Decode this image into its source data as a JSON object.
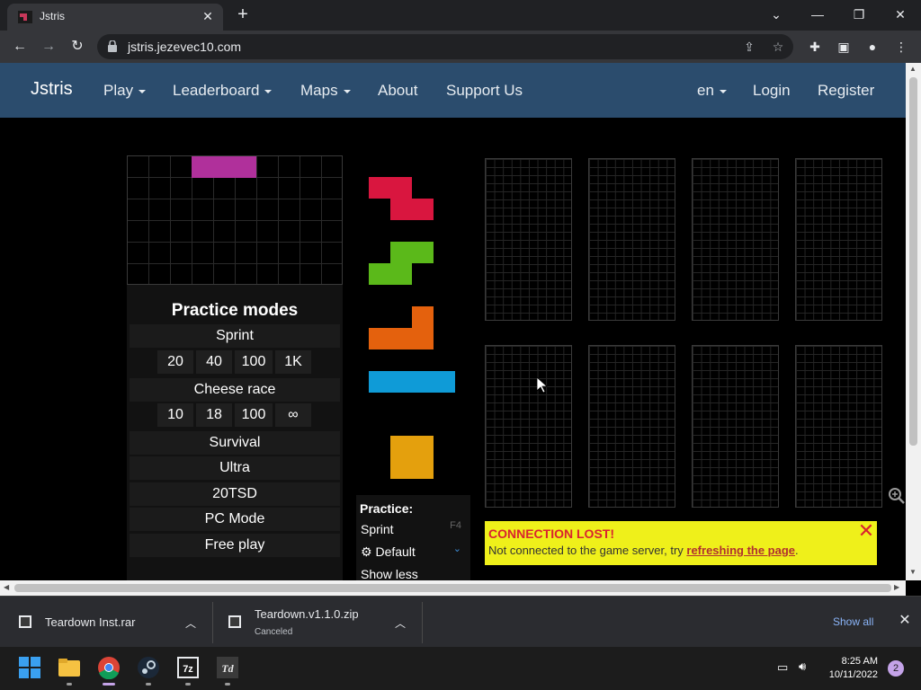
{
  "browser": {
    "tab_title": "Jstris",
    "url": "jstris.jezevec10.com"
  },
  "site_nav": {
    "brand": "Jstris",
    "items": [
      {
        "label": "Play",
        "dropdown": true
      },
      {
        "label": "Leaderboard",
        "dropdown": true
      },
      {
        "label": "Maps",
        "dropdown": true
      },
      {
        "label": "About",
        "dropdown": false
      },
      {
        "label": "Support Us",
        "dropdown": false
      }
    ],
    "language": "en",
    "login": "Login",
    "register": "Register"
  },
  "practice_modes": {
    "title": "Practice modes",
    "sprint": {
      "label": "Sprint",
      "options": [
        "20",
        "40",
        "100",
        "1K"
      ]
    },
    "cheese": {
      "label": "Cheese race",
      "options": [
        "10",
        "18",
        "100",
        "∞"
      ]
    },
    "others": [
      "Survival",
      "Ultra",
      "20TSD",
      "PC Mode",
      "Free play"
    ]
  },
  "queue_colors": [
    "#d9163f",
    "#5bb91a",
    "#e4610d",
    "#0f9bd7",
    "#e4a00d"
  ],
  "info_panel": {
    "title": "Practice:",
    "mode": "Sprint",
    "mode_key": "F4",
    "preset": "Default",
    "toggle": "Show less"
  },
  "alert": {
    "title": "CONNECTION LOST!",
    "text": "Not connected to the game server, try ",
    "link": "refreshing the page",
    "suffix": "."
  },
  "downloads": [
    {
      "name": "Teardown Inst.rar",
      "status": ""
    },
    {
      "name": "Teardown.v1.1.0.zip",
      "status": "Canceled"
    }
  ],
  "downloads_show_all": "Show all",
  "taskbar": {
    "time": "8:25 AM",
    "date": "10/11/2022",
    "notifications": "2"
  }
}
